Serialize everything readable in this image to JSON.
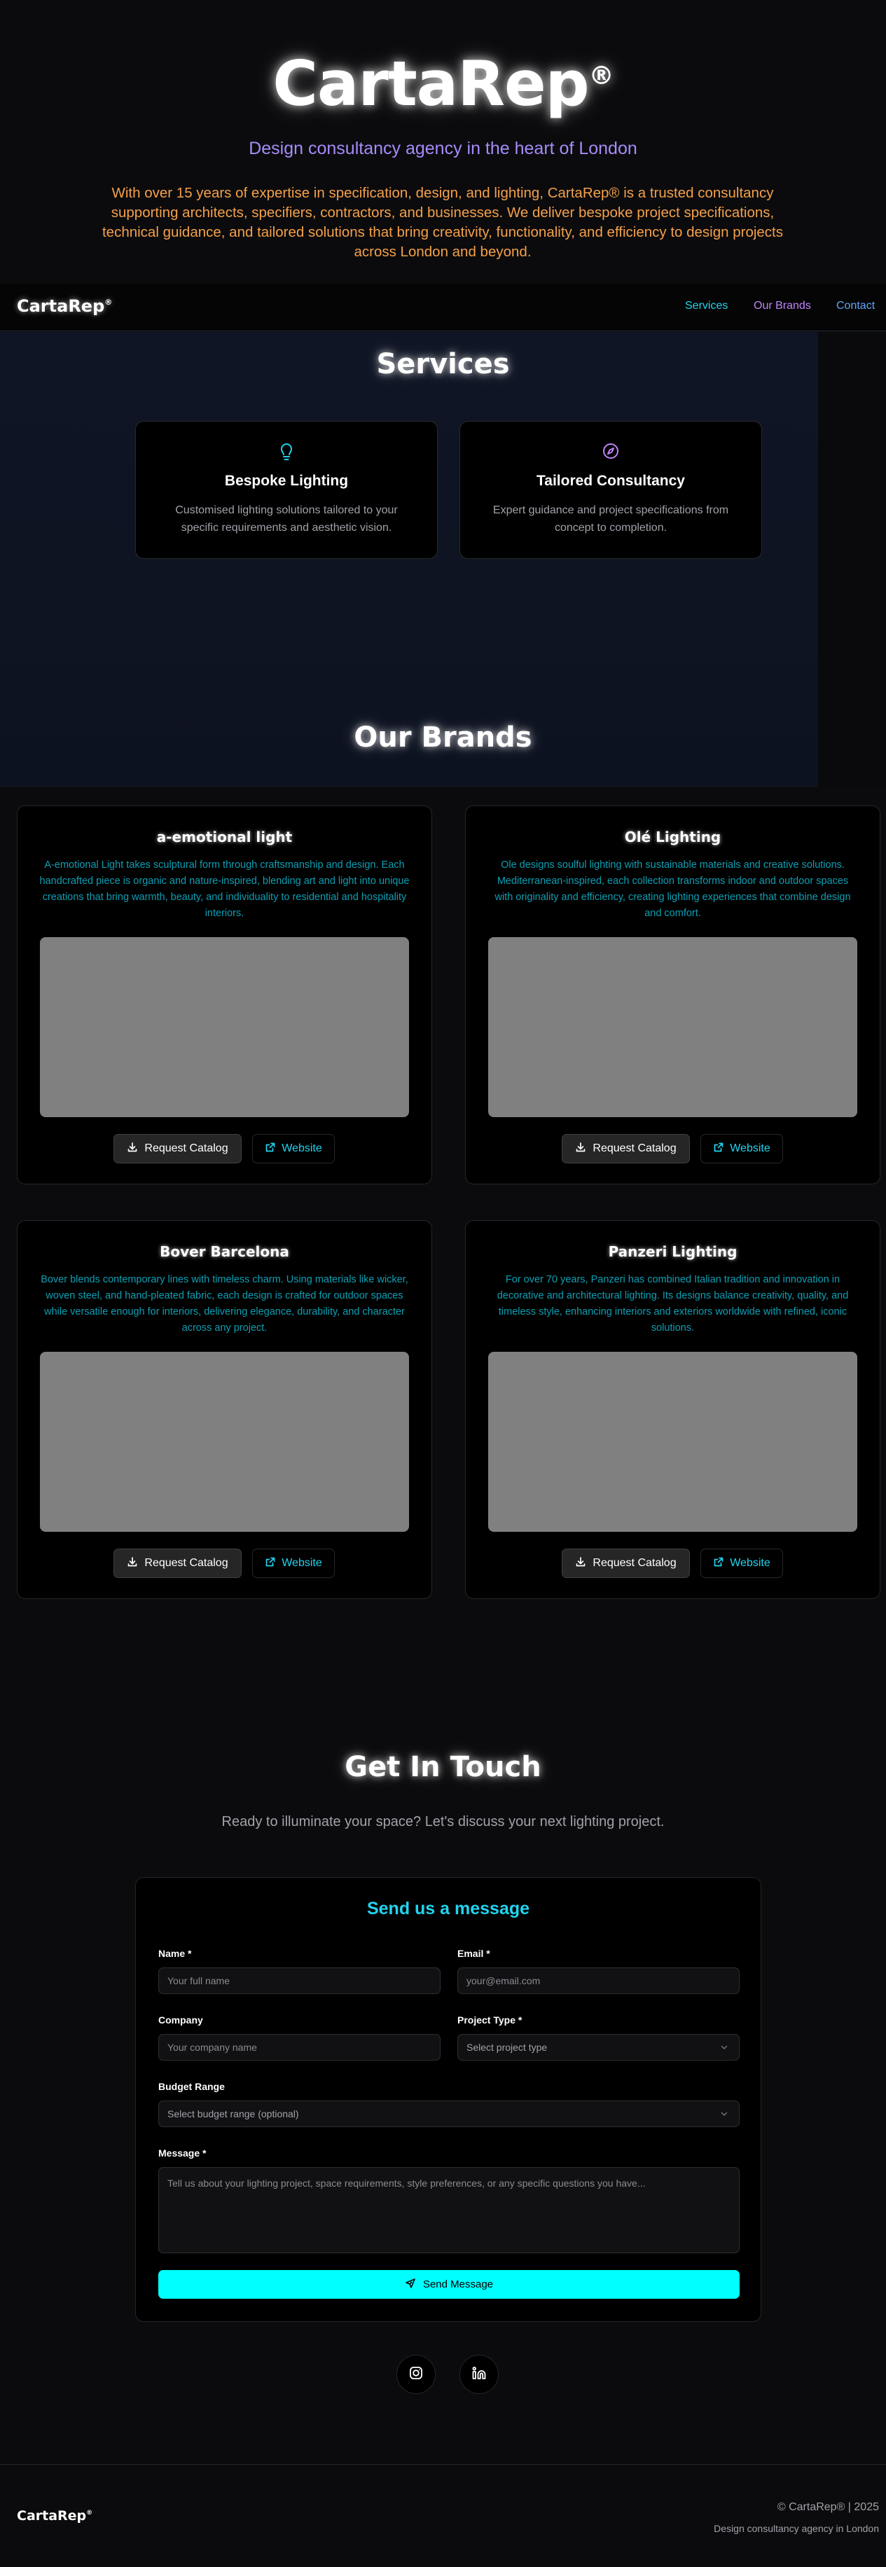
{
  "hero": {
    "logo_text": "CartaRep",
    "logo_mark": "®",
    "tagline": "Design consultancy agency in the heart of London",
    "description": "With over 15 years of expertise in specification, design, and lighting, CartaRep® is a trusted consultancy supporting architects, specifiers, contractors, and businesses. We deliver bespoke project specifications, technical guidance, and tailored solutions that bring creativity, functionality, and efficiency to design projects across London and beyond."
  },
  "nav": {
    "logo_text": "CartaRep",
    "logo_mark": "®",
    "links": [
      {
        "label": "Services",
        "color": "#22d3ee"
      },
      {
        "label": "Our Brands",
        "color": "#c084fc"
      },
      {
        "label": "Contact",
        "color": "#60a5fa"
      }
    ]
  },
  "services": {
    "title": "Services",
    "items": [
      {
        "icon": "lightbulb-icon",
        "icon_color": "#22d3ee",
        "title": "Bespoke Lighting",
        "description": "Customised lighting solutions tailored to your specific requirements and aesthetic vision."
      },
      {
        "icon": "compass-icon",
        "icon_color": "#c084fc",
        "title": "Tailored Consultancy",
        "description": "Expert guidance and project specifications from concept to completion."
      }
    ]
  },
  "brands": {
    "title": "Our Brands",
    "catalog_label": "Request Catalog",
    "website_label": "Website",
    "items": [
      {
        "name": "a-emotional light",
        "description": "A-emotional Light takes sculptural form through craftsmanship and design. Each handcrafted piece is organic and nature-inspired, blending art and light into unique creations that bring warmth, beauty, and individuality to residential and hospitality interiors."
      },
      {
        "name": "Olé Lighting",
        "description": "Ole designs soulful lighting with sustainable materials and creative solutions. Mediterranean-inspired, each collection transforms indoor and outdoor spaces with originality and efficiency, creating lighting experiences that combine design and comfort."
      },
      {
        "name": "Bover Barcelona",
        "description": "Bover blends contemporary lines with timeless charm. Using materials like wicker, woven steel, and hand-pleated fabric, each design is crafted for outdoor spaces while versatile enough for interiors, delivering elegance, durability, and character across any project."
      },
      {
        "name": "Panzeri Lighting",
        "description": "For over 70 years, Panzeri has combined Italian tradition and innovation in decorative and architectural lighting. Its designs balance creativity, quality, and timeless style, enhancing interiors and exteriors worldwide with refined, iconic solutions."
      }
    ]
  },
  "contact": {
    "title": "Get In Touch",
    "subtitle": "Ready to illuminate your space? Let's discuss your next lighting project.",
    "form": {
      "title": "Send us a message",
      "name_label": "Name *",
      "name_placeholder": "Your full name",
      "email_label": "Email *",
      "email_placeholder": "your@email.com",
      "company_label": "Company",
      "company_placeholder": "Your company name",
      "project_type_label": "Project Type *",
      "project_type_value": "Select project type",
      "budget_label": "Budget Range",
      "budget_value": "Select budget range (optional)",
      "message_label": "Message *",
      "message_placeholder": "Tell us about your lighting project, space requirements, style preferences, or any specific questions you have...",
      "submit_label": "Send Message"
    },
    "social": [
      {
        "icon": "instagram-icon"
      },
      {
        "icon": "linkedin-icon"
      }
    ]
  },
  "footer": {
    "logo_text": "CartaRep",
    "logo_mark": "®",
    "copyright": "© CartaRep® | 2025",
    "tagline": "Design consultancy agency in London"
  }
}
